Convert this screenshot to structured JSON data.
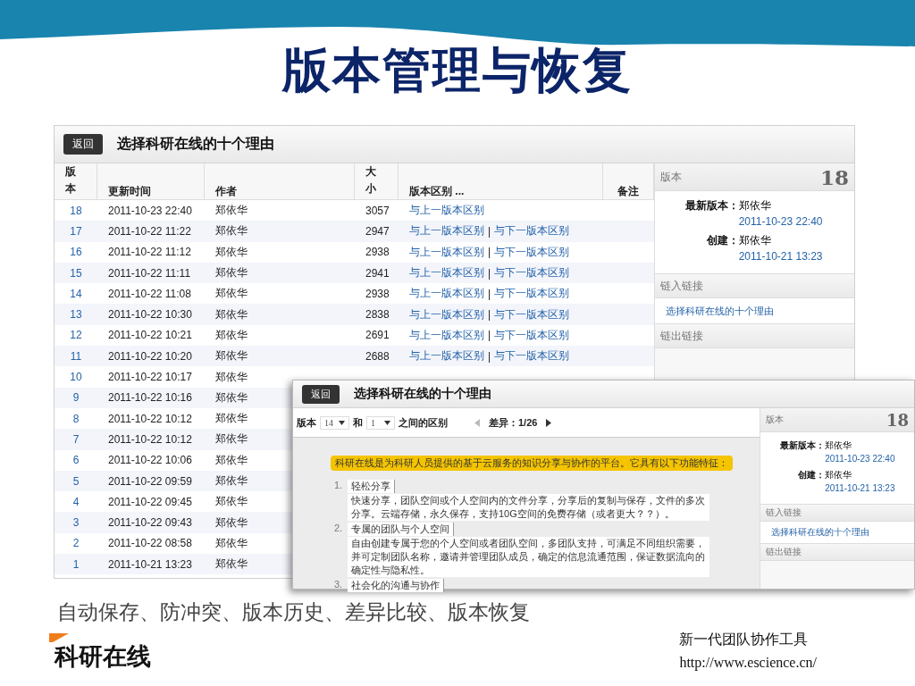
{
  "slide": {
    "title": "版本管理与恢复",
    "caption": "自动保存、防冲突、版本历史、差异比较、版本恢复",
    "logo": "科研在线",
    "footer_lines": [
      "新一代团队协作工具",
      "http://www.escience.cn/"
    ]
  },
  "history_page": {
    "back_button": "返回",
    "title": "选择科研在线的十个理由",
    "columns": [
      {
        "label": "版本",
        "kind": "stacked"
      },
      {
        "label": "更新时间",
        "kind": "plain"
      },
      {
        "label": "作者",
        "kind": "plain"
      },
      {
        "label": "大小",
        "kind": "stacked"
      },
      {
        "label": "版本区别 ...",
        "kind": "plain"
      },
      {
        "label": "备注",
        "kind": "plain"
      }
    ],
    "rows": [
      {
        "version": "18",
        "time": "2011-10-23 22:40",
        "author": "郑依华",
        "size": "3057",
        "prev_link": "与上一版本区别"
      },
      {
        "version": "17",
        "time": "2011-10-22 11:22",
        "author": "郑依华",
        "size": "2947",
        "prev_link": "与上一版本区别",
        "separator": "|",
        "next_link": "与下一版本区别"
      },
      {
        "version": "16",
        "time": "2011-10-22 11:12",
        "author": "郑依华",
        "size": "2938",
        "prev_link": "与上一版本区别",
        "separator": "|",
        "next_link": "与下一版本区别"
      },
      {
        "version": "15",
        "time": "2011-10-22 11:11",
        "author": "郑依华",
        "size": "2941",
        "prev_link": "与上一版本区别",
        "separator": "|",
        "next_link": "与下一版本区别"
      },
      {
        "version": "14",
        "time": "2011-10-22 11:08",
        "author": "郑依华",
        "size": "2938",
        "prev_link": "与上一版本区别",
        "separator": "|",
        "next_link": "与下一版本区别"
      },
      {
        "version": "13",
        "time": "2011-10-22 10:30",
        "author": "郑依华",
        "size": "2838",
        "prev_link": "与上一版本区别",
        "separator": "|",
        "next_link": "与下一版本区别"
      },
      {
        "version": "12",
        "time": "2011-10-22 10:21",
        "author": "郑依华",
        "size": "2691",
        "prev_link": "与上一版本区别",
        "separator": "|",
        "next_link": "与下一版本区别"
      },
      {
        "version": "11",
        "time": "2011-10-22 10:20",
        "author": "郑依华",
        "size": "2688",
        "prev_link": "与上一版本区别",
        "separator": "|",
        "next_link": "与下一版本区别"
      },
      {
        "version": "10",
        "time": "2011-10-22 10:17",
        "author": "郑依华"
      },
      {
        "version": "9",
        "time": "2011-10-22 10:16",
        "author": "郑依华"
      },
      {
        "version": "8",
        "time": "2011-10-22 10:12",
        "author": "郑依华"
      },
      {
        "version": "7",
        "time": "2011-10-22 10:12",
        "author": "郑依华"
      },
      {
        "version": "6",
        "time": "2011-10-22 10:06",
        "author": "郑依华"
      },
      {
        "version": "5",
        "time": "2011-10-22 09:59",
        "author": "郑依华"
      },
      {
        "version": "4",
        "time": "2011-10-22 09:45",
        "author": "郑依华"
      },
      {
        "version": "3",
        "time": "2011-10-22 09:43",
        "author": "郑依华"
      },
      {
        "version": "2",
        "time": "2011-10-22 08:58",
        "author": "郑依华"
      },
      {
        "version": "1",
        "time": "2011-10-21 13:23",
        "author": "郑依华"
      }
    ],
    "sidebar": {
      "version_label": "版本",
      "version_number": "18",
      "fields": [
        {
          "label": "最新版本：",
          "name": "郑依华",
          "time": "2011-10-23 22:40"
        },
        {
          "label": "创建：",
          "name": "郑依华",
          "time": "2011-10-21 13:23"
        }
      ],
      "inbound_title": "链入链接",
      "inbound_links": [
        "选择科研在线的十个理由"
      ],
      "outbound_title": "链出链接"
    }
  },
  "diff_page": {
    "back_button": "返回",
    "title": "选择科研在线的十个理由",
    "toolbar": {
      "version_label": "版本",
      "from": "14",
      "and": "和",
      "to": "1",
      "between": "之间的区别",
      "counter": "差异：1/26",
      "prev_disabled": true,
      "next_disabled": false
    },
    "highlight": "科研在线是为科研人员提供的基于云服务的知识分享与协作的平台。它具有以下功能特征：",
    "items": [
      {
        "number": "1.",
        "title": "轻松分享",
        "text": "快速分享，团队空间或个人空间内的文件分享，分享后的复制与保存，文件的多次分享。云端存储，永久保存，支持10G空间的免费存储（或者更大？？）。"
      },
      {
        "number": "2.",
        "title": "专属的团队与个人空间",
        "text": "自由创建专属于您的个人空间或者团队空间，多团队支持，可满足不同组织需要，并可定制团队名称，邀请并管理团队成员，确定的信息流通范围，保证数据流向的确定性与隐私性。"
      },
      {
        "number": "3.",
        "title": "社会化的沟通与协作"
      }
    ],
    "sidebar": {
      "version_label": "版本",
      "version_number": "18",
      "fields": [
        {
          "label": "最新版本：",
          "name": "郑依华",
          "time": "2011-10-23 22:40"
        },
        {
          "label": "创建：",
          "name": "郑依华",
          "time": "2011-10-21 13:23"
        }
      ],
      "inbound_title": "链入链接",
      "inbound_links": [
        "选择科研在线的十个理由"
      ],
      "outbound_title": "链出链接"
    }
  }
}
